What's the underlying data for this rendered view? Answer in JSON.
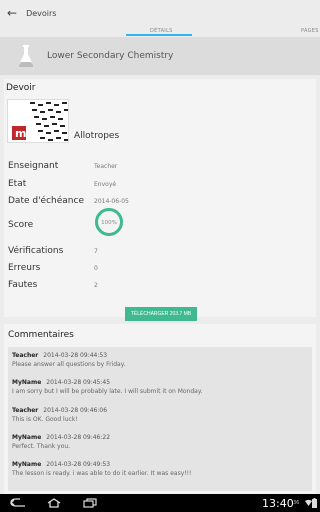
{
  "action_bar": {
    "title": "Devoirs",
    "back_icon": "arrow-left-icon"
  },
  "tabs": [
    {
      "label": "DÉTAILS",
      "selected": true
    },
    {
      "label": "PAGES",
      "selected": false
    }
  ],
  "course": {
    "title": "Lower Secondary Chemistry",
    "icon": "flask-icon"
  },
  "assignment": {
    "section_title": "Devoir",
    "name": "Allotropes",
    "fields": {
      "teacher_label": "Enseignant",
      "teacher_value": "Teacher",
      "state_label": "Etat",
      "state_value": "Envoyé",
      "due_label": "Date d'échéance",
      "due_value": "2014-06-05",
      "score_label": "Score",
      "score_value": "100%",
      "checks_label": "Vérifications",
      "checks_value": "7",
      "errors_label": "Erreurs",
      "errors_value": "0",
      "faults_label": "Fautes",
      "faults_value": "2"
    },
    "score_fraction": 1.0,
    "download_label": "TÉLÉCHARGER 203.7 MB"
  },
  "comments": {
    "section_title": "Commentaires",
    "items": [
      {
        "author": "Teacher",
        "date": "2014-03-28 09:44:53",
        "text": "Please answer all questions by Friday."
      },
      {
        "author": "MyName",
        "date": "2014-03-28 09:45:45",
        "text": "I am sorry but I will be probably late. I will submit it on Monday."
      },
      {
        "author": "Teacher",
        "date": "2014-03-28 09:46:06",
        "text": "This is OK. Good luck!"
      },
      {
        "author": "MyName",
        "date": "2014-03-28 09:46:22",
        "text": "Perfect. Thank you."
      },
      {
        "author": "MyName",
        "date": "2014-03-28 09:49:53",
        "text": "The lesson is ready. i was able to do it earlier. It was easy!!!"
      }
    ]
  },
  "status_bar": {
    "time": "13:40",
    "extra": "36",
    "colors": {
      "accent": "#33b5e5",
      "score": "#3fb990"
    }
  }
}
